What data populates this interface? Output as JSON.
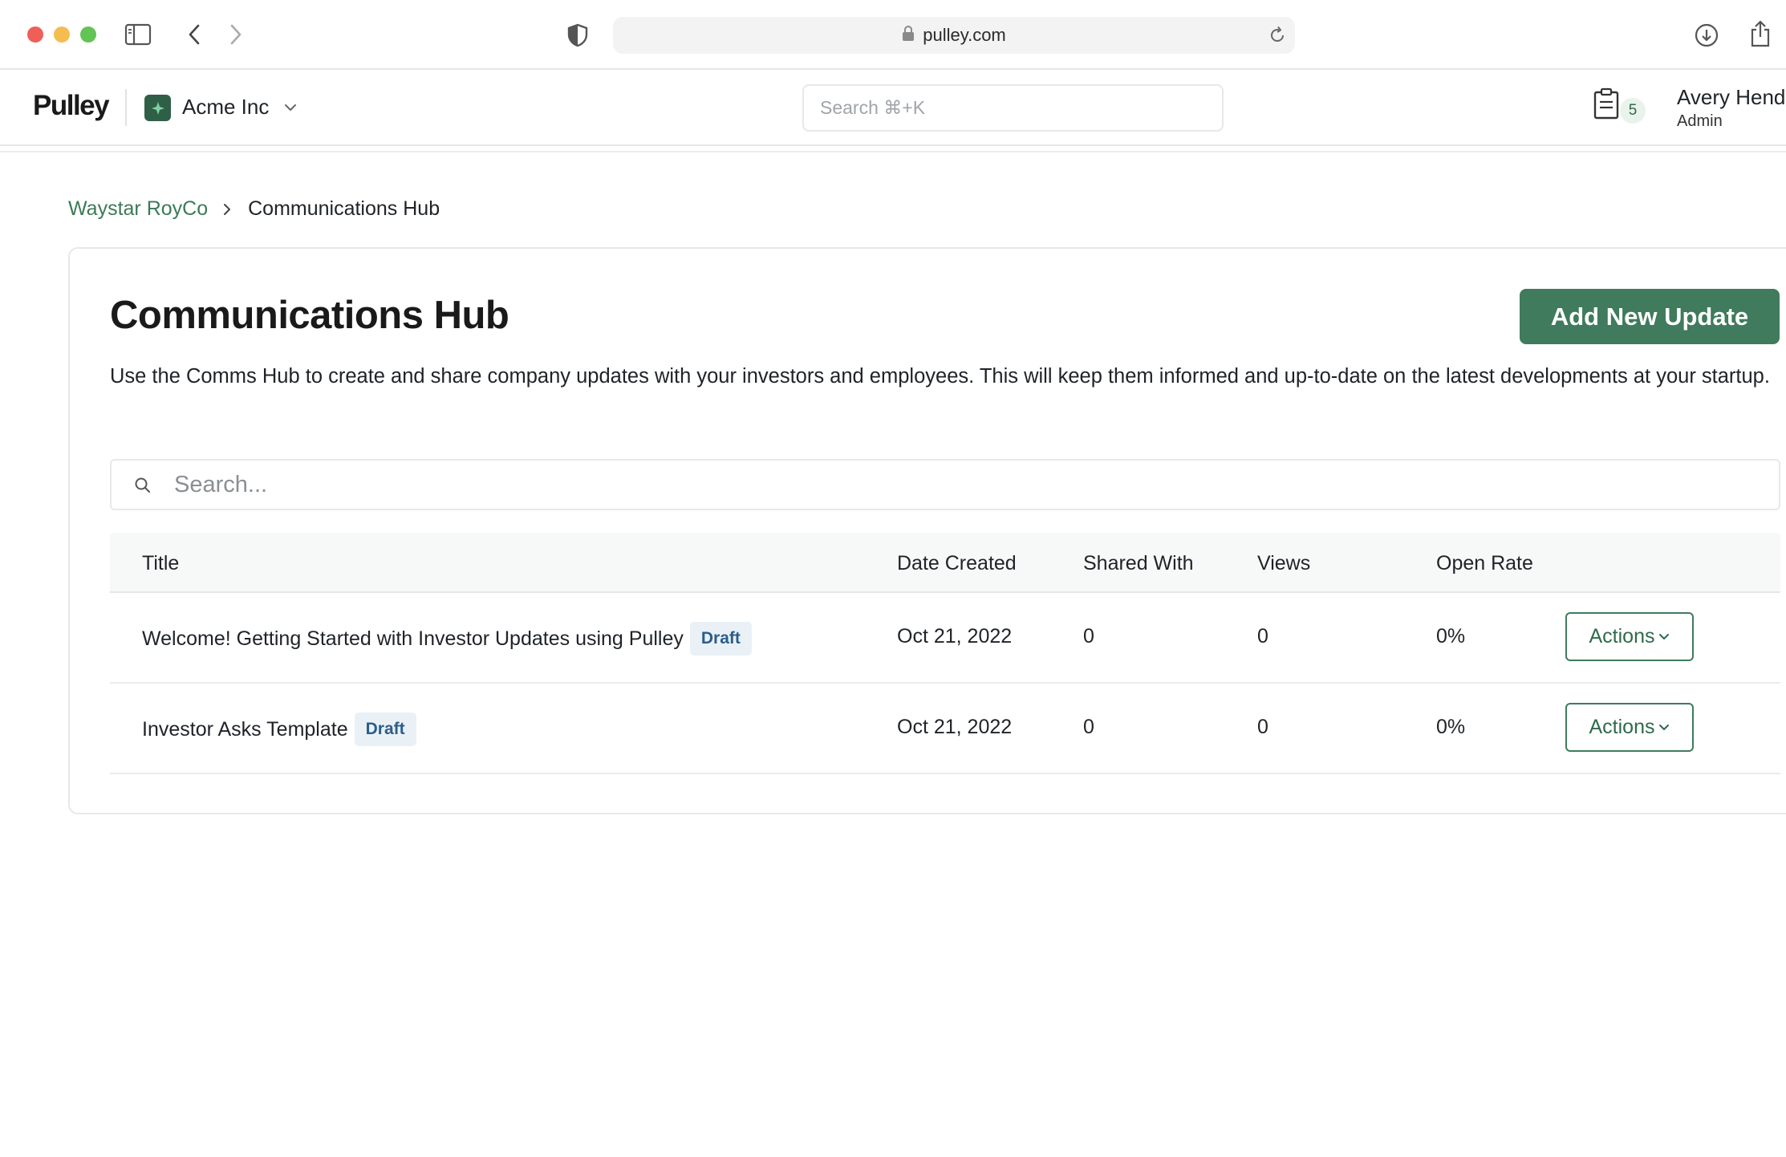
{
  "browser": {
    "url": "pulley.com"
  },
  "header": {
    "logo": "Pulley",
    "org_name": "Acme Inc",
    "search_placeholder": "Search ⌘+K",
    "tasks_count": "5",
    "user_name": "Avery Hend",
    "user_role": "Admin"
  },
  "breadcrumb": {
    "parent": "Waystar RoyCo",
    "current": "Communications Hub"
  },
  "main": {
    "title": "Communications Hub",
    "add_button_label": "Add New Update",
    "description": "Use the Comms Hub to create and share company updates with your investors and employees. This will keep them informed and up-to-date on the latest developments at your startup.",
    "search_placeholder": "Search...",
    "table": {
      "columns": [
        "Title",
        "Date Created",
        "Shared With",
        "Views",
        "Open Rate"
      ],
      "rows": [
        {
          "title": "Welcome! Getting Started with Investor Updates using Pulley",
          "badge": "Draft",
          "date_created": "Oct 21, 2022",
          "shared_with": "0",
          "views": "0",
          "open_rate": "0%",
          "actions_label": "Actions"
        },
        {
          "title": "Investor Asks Template",
          "badge": "Draft",
          "date_created": "Oct 21, 2022",
          "shared_with": "0",
          "views": "0",
          "open_rate": "0%",
          "actions_label": "Actions"
        }
      ]
    }
  },
  "colors": {
    "brand_green": "#3f7b5c",
    "link_green": "#3b7a57",
    "badge_bg": "#eaf1f6",
    "badge_text": "#2b5d8a"
  },
  "icons": {
    "sidebar_toggle": "sidebar-icon",
    "back": "chevron-left-icon",
    "forward": "chevron-right-icon",
    "privacy": "shield-icon",
    "lock": "lock-icon",
    "reload": "reload-icon",
    "download": "download-icon",
    "share": "share-icon",
    "tasks": "clipboard-icon",
    "search": "search-icon"
  }
}
